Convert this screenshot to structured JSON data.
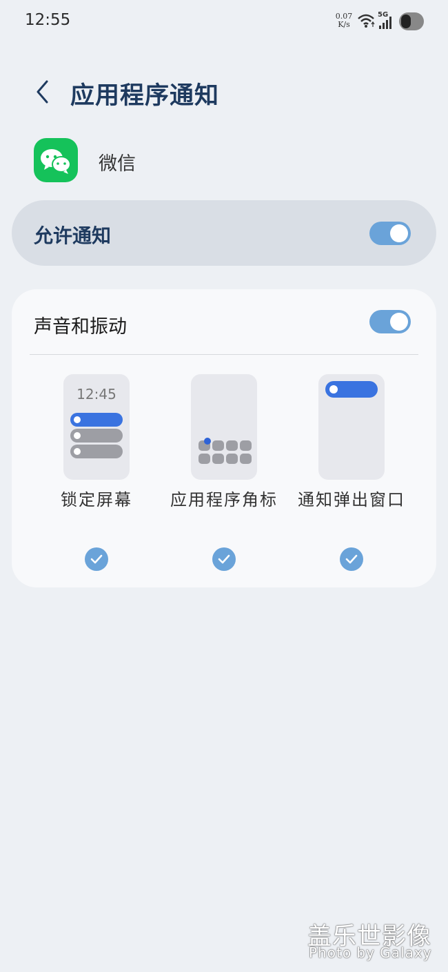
{
  "status_bar": {
    "time": "12:55",
    "speed_value": "0.07",
    "speed_unit": "K/s",
    "network": "5G",
    "icons": [
      "wifi-icon",
      "signal-icon",
      "battery-saver-toggle-icon"
    ]
  },
  "header": {
    "title": "应用程序通知",
    "back_icon": "chevron-left-icon"
  },
  "app": {
    "name": "微信",
    "icon": "wechat-icon",
    "icon_color": "#15c25a"
  },
  "allow_notifications": {
    "label": "允许通知",
    "enabled": true
  },
  "sound_vibration": {
    "label": "声音和振动",
    "enabled": true
  },
  "notification_types": [
    {
      "label": "锁定屏幕",
      "checked": true,
      "preview_time": "12:45"
    },
    {
      "label": "应用程序角标",
      "checked": true
    },
    {
      "label": "通知弹出窗口",
      "checked": true
    }
  ],
  "watermark": {
    "line1": "盖乐世影像",
    "line2": "Photo by Galaxy"
  },
  "colors": {
    "accent": "#6aa3d9",
    "title": "#1e3a5f",
    "preview_blue": "#3a73e0"
  }
}
